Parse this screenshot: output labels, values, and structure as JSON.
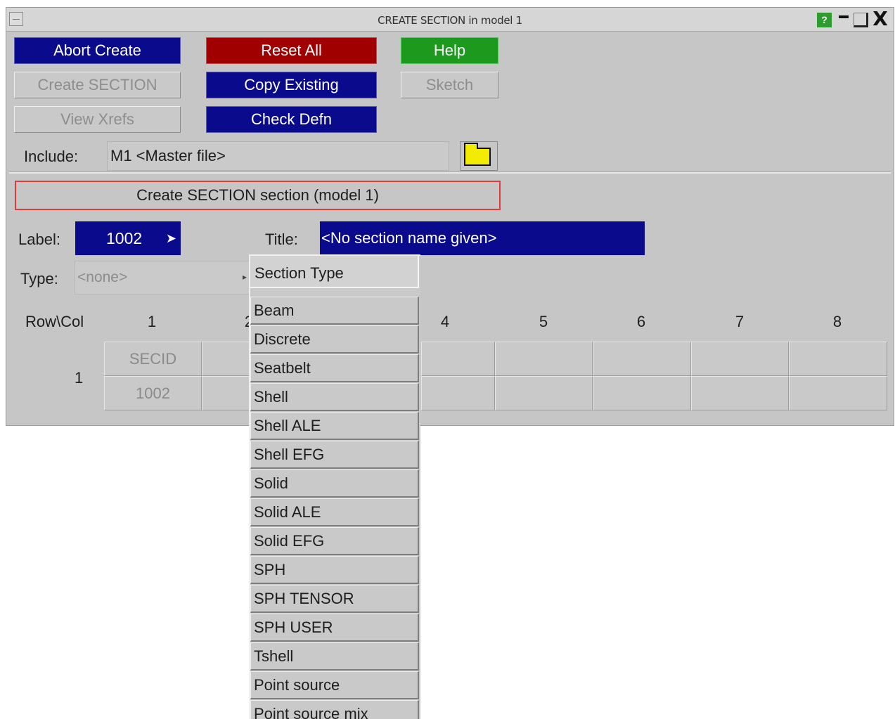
{
  "window": {
    "title": "CREATE SECTION in model 1",
    "help_icon": "?",
    "close_icon": "X"
  },
  "buttons": {
    "abort_create": "Abort Create",
    "create_section": "Create SECTION",
    "view_xrefs": "View Xrefs",
    "reset_all": "Reset All",
    "copy_existing": "Copy Existing",
    "check_defn": "Check Defn",
    "help": "Help",
    "sketch": "Sketch"
  },
  "include": {
    "label": "Include:",
    "value": "M1  <Master file>"
  },
  "section_banner": "Create SECTION section (model 1)",
  "label_field": {
    "label": "Label:",
    "value": "1002",
    "arrow": "➤"
  },
  "title_field": {
    "label": "Title:",
    "value": "<No section name given>"
  },
  "type_field": {
    "label": "Type:",
    "value": "<none>",
    "arrow": "▸"
  },
  "grid": {
    "rowcol_label": "Row\\Col",
    "columns": [
      "1",
      "2",
      "4",
      "5",
      "6",
      "7",
      "8"
    ],
    "row_label": "1",
    "header_cell": "SECID",
    "value_cell": "1002"
  },
  "popup": {
    "heading": "Section Type",
    "items": [
      "Beam",
      "Discrete",
      "Seatbelt",
      "Shell",
      "Shell ALE",
      "Shell EFG",
      "Solid",
      "Solid ALE",
      "Solid EFG",
      "SPH",
      "SPH TENSOR",
      "SPH USER",
      "Tshell",
      "Point source",
      "Point source mix"
    ]
  },
  "colors": {
    "button_blue": "#0a0a8c",
    "button_red": "#a00000",
    "button_green": "#1d9a1d",
    "panel_grey": "#c6c6c6",
    "folder_yellow": "#f3ec00",
    "banner_border": "#e43a3a"
  }
}
